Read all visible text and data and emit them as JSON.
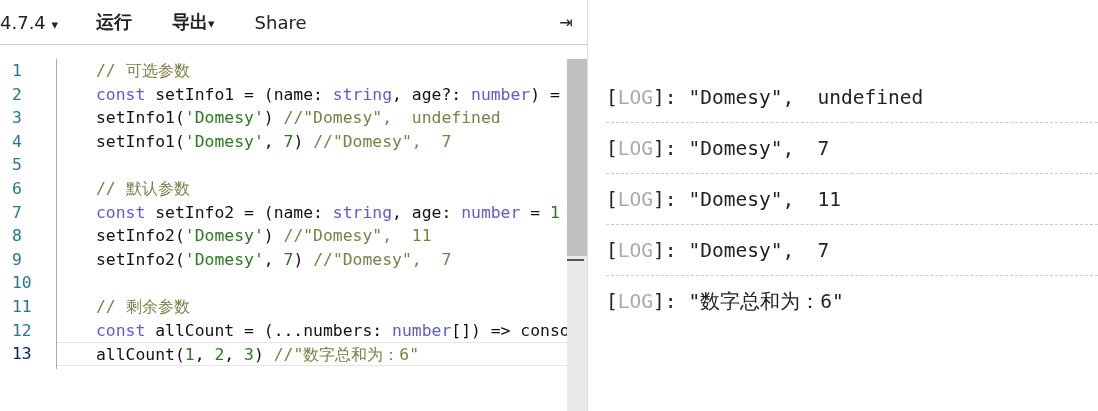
{
  "toolbar": {
    "version": "4.7.4",
    "caret": "▾",
    "items": [
      {
        "label": "运行",
        "kind": "plain",
        "bold": true
      },
      {
        "label": "导出",
        "kind": "menu",
        "bold": true
      },
      {
        "label": "Share",
        "kind": "plain",
        "bold": false
      }
    ],
    "collapse": "⇥"
  },
  "editor": {
    "lines": [
      {
        "number": "1",
        "tokens": [
          {
            "text": "// 可选参数",
            "kind": "comment"
          }
        ]
      },
      {
        "number": "2",
        "tokens": [
          {
            "text": "const",
            "kind": "keyword"
          },
          {
            "text": " setInfo1 = (name: ",
            "kind": "plain"
          },
          {
            "text": "string",
            "kind": "keyword"
          },
          {
            "text": ", age?: ",
            "kind": "plain"
          },
          {
            "text": "number",
            "kind": "keyword"
          },
          {
            "text": ") =",
            "kind": "plain"
          }
        ]
      },
      {
        "number": "3",
        "tokens": [
          {
            "text": "setInfo1(",
            "kind": "plain"
          },
          {
            "text": "'Domesy'",
            "kind": "string"
          },
          {
            "text": ") ",
            "kind": "plain"
          },
          {
            "text": "//\"Domesy\",  undefined",
            "kind": "comment"
          }
        ]
      },
      {
        "number": "4",
        "tokens": [
          {
            "text": "setInfo1(",
            "kind": "plain"
          },
          {
            "text": "'Domesy'",
            "kind": "string"
          },
          {
            "text": ", ",
            "kind": "plain"
          },
          {
            "text": "7",
            "kind": "number"
          },
          {
            "text": ") ",
            "kind": "plain"
          },
          {
            "text": "//\"Domesy\",  7",
            "kind": "comment"
          }
        ]
      },
      {
        "number": "5"
      },
      {
        "number": "6",
        "tokens": [
          {
            "text": "// 默认参数",
            "kind": "comment"
          }
        ]
      },
      {
        "number": "7",
        "tokens": [
          {
            "text": "const",
            "kind": "keyword"
          },
          {
            "text": " setInfo2 = (name: ",
            "kind": "plain"
          },
          {
            "text": "string",
            "kind": "keyword"
          },
          {
            "text": ", age: ",
            "kind": "plain"
          },
          {
            "text": "number",
            "kind": "keyword"
          },
          {
            "text": " = ",
            "kind": "plain"
          },
          {
            "text": "1",
            "kind": "number"
          }
        ]
      },
      {
        "number": "8",
        "tokens": [
          {
            "text": "setInfo2(",
            "kind": "plain"
          },
          {
            "text": "'Domesy'",
            "kind": "string"
          },
          {
            "text": ") ",
            "kind": "plain"
          },
          {
            "text": "//\"Domesy\",  11",
            "kind": "comment"
          }
        ]
      },
      {
        "number": "9",
        "tokens": [
          {
            "text": "setInfo2(",
            "kind": "plain"
          },
          {
            "text": "'Domesy'",
            "kind": "string"
          },
          {
            "text": ", ",
            "kind": "plain"
          },
          {
            "text": "7",
            "kind": "number"
          },
          {
            "text": ") ",
            "kind": "plain"
          },
          {
            "text": "//\"Domesy\",  7",
            "kind": "comment"
          }
        ]
      },
      {
        "number": "10"
      },
      {
        "number": "11",
        "tokens": [
          {
            "text": "// 剩余参数",
            "kind": "comment"
          }
        ]
      },
      {
        "number": "12",
        "current": false,
        "tokens": [
          {
            "text": "const",
            "kind": "keyword"
          },
          {
            "text": " allCount = (...numbers: ",
            "kind": "plain"
          },
          {
            "text": "number",
            "kind": "keyword"
          },
          {
            "text": "[]) => conso",
            "kind": "plain"
          }
        ]
      },
      {
        "number": "13",
        "current": true,
        "tokens": [
          {
            "text": "allCount(",
            "kind": "plain"
          },
          {
            "text": "1",
            "kind": "number"
          },
          {
            "text": ", ",
            "kind": "plain"
          },
          {
            "text": "2",
            "kind": "number"
          },
          {
            "text": ", ",
            "kind": "plain"
          },
          {
            "text": "3",
            "kind": "number"
          },
          {
            "text": ") ",
            "kind": "plain"
          },
          {
            "text": "//\"数字总和为：6\"",
            "kind": "comment"
          }
        ]
      }
    ]
  },
  "console": [
    {
      "open": "[",
      "tag": "LOG",
      "close": "]:",
      "message": "\"Domesy\",  undefined"
    },
    {
      "open": "[",
      "tag": "LOG",
      "close": "]:",
      "message": "\"Domesy\",  7"
    },
    {
      "open": "[",
      "tag": "LOG",
      "close": "]:",
      "message": "\"Domesy\",  11"
    },
    {
      "open": "[",
      "tag": "LOG",
      "close": "]:",
      "message": "\"Domesy\",  7"
    },
    {
      "open": "[",
      "tag": "LOG",
      "close": "]:",
      "message": "\"数字总和为：6\""
    }
  ]
}
